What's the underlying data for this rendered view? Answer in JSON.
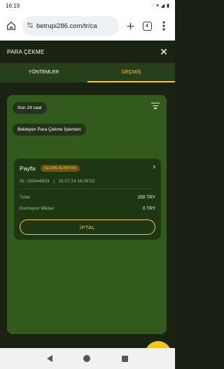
{
  "status_bar": {
    "time": "16:19"
  },
  "browser": {
    "url": "betrupi286.com/tr/ca",
    "tab_count": "4"
  },
  "header": {
    "title": "PARA ÇEKME"
  },
  "tabs": [
    {
      "label": "YÖNTEMLER",
      "active": false
    },
    {
      "label": "GEÇMİŞ",
      "active": true
    }
  ],
  "filters": {
    "time_range": "Son 24 saat",
    "pending_label": "Bekleyen Para Çekme İşlemleri"
  },
  "transaction": {
    "method": "Payfix",
    "status": "İŞLEME ALINIYOR",
    "id_text": "ID: 155444903",
    "separator": "|",
    "datetime": "15.07.24 16:09:52",
    "amount_label": "Tutar",
    "amount_value": "250 TRY",
    "fee_label": "Komisyon Miktarı",
    "fee_value": "0 TRY",
    "cancel_label": "İPTAL"
  },
  "colors": {
    "accent": "#f2c94c",
    "panel": "#315a1c",
    "card": "#1e3612",
    "background": "#1a2312"
  }
}
